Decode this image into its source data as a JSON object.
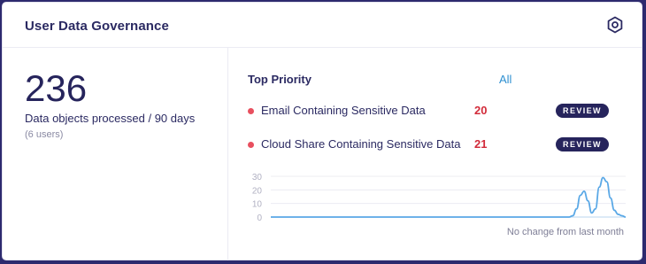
{
  "widget": {
    "title": "User Data Governance",
    "settings_icon": "hexagon-settings-icon"
  },
  "summary": {
    "count": "236",
    "label": "Data objects processed / 90 days",
    "sublabel": "(6 users)"
  },
  "top_priority": {
    "title": "Top Priority",
    "all_label": "All",
    "items": [
      {
        "label": "Email Containing Sensitive Data",
        "count": "20",
        "action": "REVIEW"
      },
      {
        "label": "Cloud Share Containing Sensitive Data",
        "count": "21",
        "action": "REVIEW"
      }
    ]
  },
  "chart_note": "No change from last month",
  "colors": {
    "accent_dark": "#26245c",
    "alert_red": "#d22b3a",
    "link_blue": "#2d8fd0",
    "series_blue": "#5aa8e6"
  },
  "chart_data": {
    "type": "line",
    "title": "",
    "xlabel": "",
    "ylabel": "",
    "ylim": [
      0,
      30
    ],
    "yticks": [
      "30",
      "20",
      "10",
      "0"
    ],
    "grid": true,
    "series": [
      {
        "values": [
          0,
          0,
          0,
          0,
          0,
          0,
          0,
          0,
          0,
          0,
          0,
          0,
          0,
          0,
          0,
          0,
          0,
          0,
          0,
          0,
          0,
          0,
          0,
          0,
          0,
          0,
          0,
          0,
          0,
          0,
          0,
          0,
          0,
          0,
          0,
          0,
          0,
          0,
          0,
          0,
          0,
          0,
          0,
          0,
          0,
          0,
          0,
          0,
          0,
          0,
          0,
          0,
          0,
          0,
          0,
          0,
          0,
          0,
          0,
          0,
          0,
          0,
          0,
          0,
          0,
          0,
          0,
          0,
          0,
          0,
          0,
          0,
          0,
          0,
          0,
          0,
          0,
          0,
          0,
          0,
          1,
          6,
          16,
          19,
          12,
          3,
          6,
          22,
          29,
          26,
          14,
          5,
          2,
          1,
          0
        ]
      }
    ]
  }
}
